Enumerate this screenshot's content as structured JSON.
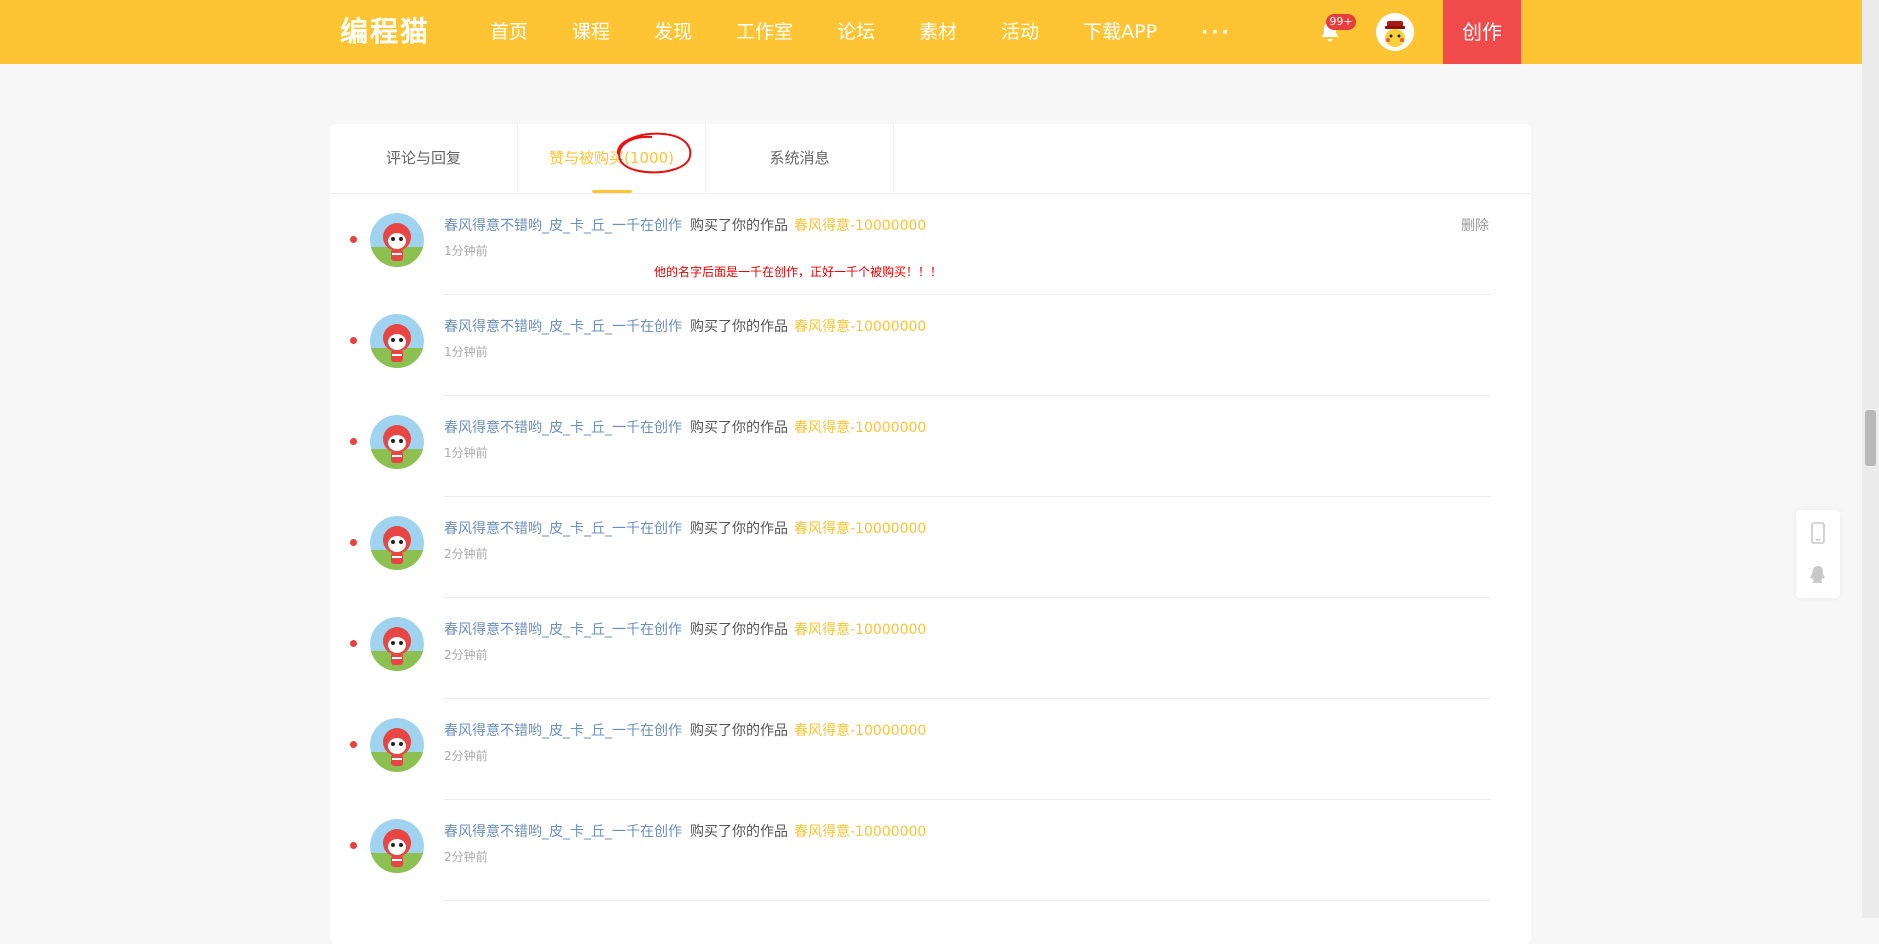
{
  "header": {
    "logo": "编程猫",
    "nav": [
      "首页",
      "课程",
      "发现",
      "工作室",
      "论坛",
      "素材",
      "活动",
      "下载APP"
    ],
    "more": "···",
    "badge": "99+",
    "create": "创作"
  },
  "tabs": [
    "评论与回复",
    "赞与被购买(1000)",
    "系统消息"
  ],
  "annotation": "他的名字后面是一千在创作，正好一千个被购买！！！",
  "delete_label": "删除",
  "colors": {
    "accent": "#fec433",
    "create": "#f04a4a",
    "username": "#6c8fc0",
    "unread": "#e94040"
  },
  "messages": [
    {
      "user": "春风得意不错哟_皮_卡_丘_一千在创作",
      "action": "购买了你的作品",
      "work": "春风得意-10000000",
      "time": "1分钟前"
    },
    {
      "user": "春风得意不错哟_皮_卡_丘_一千在创作",
      "action": "购买了你的作品",
      "work": "春风得意-10000000",
      "time": "1分钟前"
    },
    {
      "user": "春风得意不错哟_皮_卡_丘_一千在创作",
      "action": "购买了你的作品",
      "work": "春风得意-10000000",
      "time": "1分钟前"
    },
    {
      "user": "春风得意不错哟_皮_卡_丘_一千在创作",
      "action": "购买了你的作品",
      "work": "春风得意-10000000",
      "time": "2分钟前"
    },
    {
      "user": "春风得意不错哟_皮_卡_丘_一千在创作",
      "action": "购买了你的作品",
      "work": "春风得意-10000000",
      "time": "2分钟前"
    },
    {
      "user": "春风得意不错哟_皮_卡_丘_一千在创作",
      "action": "购买了你的作品",
      "work": "春风得意-10000000",
      "time": "2分钟前"
    },
    {
      "user": "春风得意不错哟_皮_卡_丘_一千在创作",
      "action": "购买了你的作品",
      "work": "春风得意-10000000",
      "time": "2分钟前"
    }
  ]
}
